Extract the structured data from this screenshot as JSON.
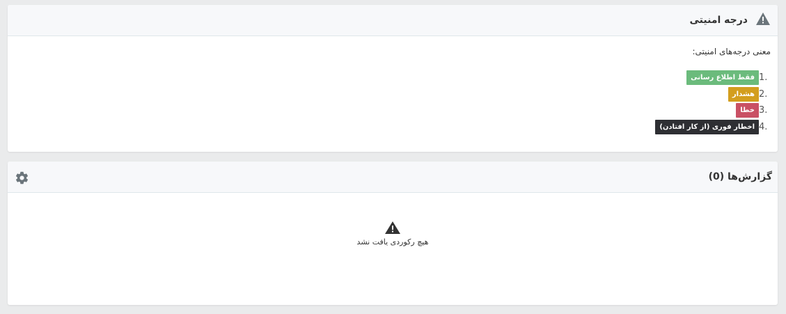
{
  "security": {
    "title": "درجه امنیتی",
    "intro": "معنی درجه‌های امنیتی:",
    "levels": [
      {
        "num": "1.",
        "label": "فقط اطلاع رسانی",
        "color": "#6bbb7c"
      },
      {
        "num": "2.",
        "label": "هشدار",
        "color": "#d39e1e"
      },
      {
        "num": "3.",
        "label": "خطا",
        "color": "#c95064"
      },
      {
        "num": "4.",
        "label": "اخطار فوری (از کار افتادن)",
        "color": "#2e2f33"
      }
    ]
  },
  "reports": {
    "title": "گزارش‌ها (0)",
    "empty_text": "هیچ رکوردی یافت نشد"
  },
  "colors": {
    "icon_gray": "#6b757b",
    "empty_icon": "#333333"
  }
}
